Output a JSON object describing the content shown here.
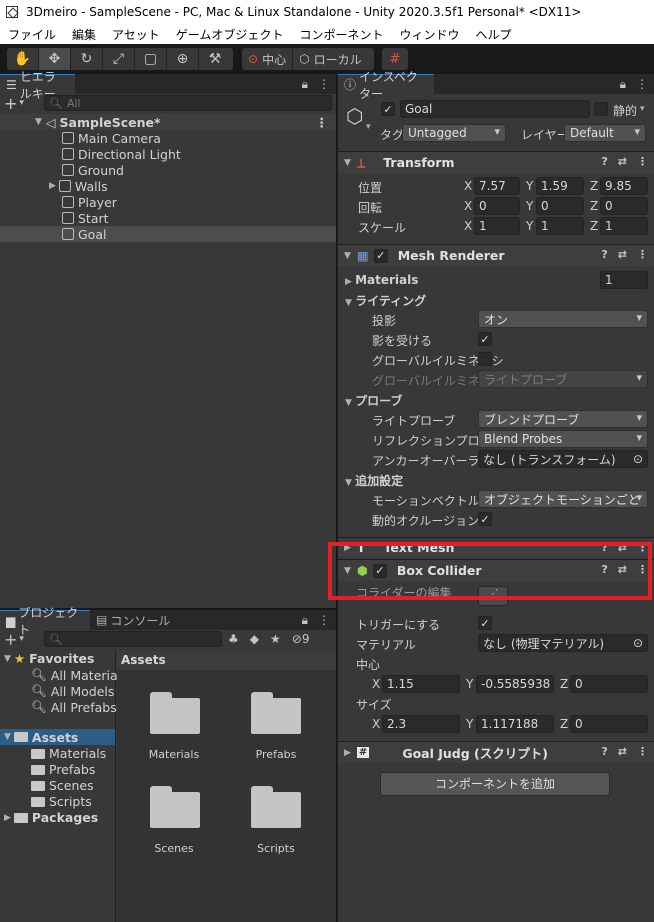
{
  "window": {
    "title": "3Dmeiro - SampleScene - PC, Mac & Linux Standalone - Unity 2020.3.5f1 Personal* <DX11>"
  },
  "menu": [
    "ファイル",
    "編集",
    "アセット",
    "ゲームオブジェクト",
    "コンポーネント",
    "ウィンドウ",
    "ヘルプ"
  ],
  "toolbar": {
    "pivot_label": "中心",
    "space_label": "ローカル"
  },
  "hierarchy": {
    "tab": "ヒエラルキー",
    "search_placeholder": "All",
    "scene": "SampleScene*",
    "items": [
      "Main Camera",
      "Directional Light",
      "Ground",
      "Walls",
      "Player",
      "Start",
      "Goal"
    ],
    "selected": "Goal"
  },
  "inspector": {
    "tab": "インスペクター",
    "object_name": "Goal",
    "static_label": "静的",
    "tag_label": "タグ",
    "tag_value": "Untagged",
    "layer_label": "レイヤー",
    "layer_value": "Default",
    "transform": {
      "title": "Transform",
      "position_label": "位置",
      "rotation_label": "回転",
      "scale_label": "スケール",
      "position": [
        "7.57",
        "1.59",
        "9.85"
      ],
      "rotation": [
        "0",
        "0",
        "0"
      ],
      "scale": [
        "1",
        "1",
        "1"
      ],
      "axis_x": "X",
      "axis_y": "Y",
      "axis_z": "Z"
    },
    "mesh_renderer": {
      "title": "Mesh Renderer",
      "materials_label": "Materials",
      "materials_count": "1",
      "lighting_label": "ライティング",
      "cast_shadows_label": "投影",
      "cast_shadows_value": "オン",
      "receive_shadows_label": "影を受ける",
      "gi_label": "グローバルイルミネーシ",
      "gi_label2": "グローバルイルミネーシ",
      "gi_value": "ライトプローブ",
      "probes_label": "プローブ",
      "light_probes_label": "ライトプローブ",
      "light_probes_value": "ブレンドプローブ",
      "reflection_label": "リフレクションプローブ",
      "reflection_value": "Blend Probes",
      "anchor_label": "アンカーオーバーライド",
      "anchor_value": "なし (トランスフォーム)",
      "additional_label": "追加設定",
      "motion_label": "モーションベクトル",
      "motion_value": "オブジェクトモーションごと",
      "occlusion_label": "動的オクルージョン"
    },
    "text_mesh_title": "Text Mesh",
    "box_collider": {
      "title": "Box Collider",
      "edit_label": "コライダーの編集",
      "trigger_label": "トリガーにする",
      "material_label": "マテリアル",
      "material_value": "なし (物理マテリアル)",
      "center_label": "中心",
      "center": [
        "1.15",
        "-0.5585938",
        "0"
      ],
      "size_label": "サイズ",
      "size": [
        "2.3",
        "1.117188",
        "0"
      ]
    },
    "goal_script_title": "Goal Judg (スクリプト)",
    "add_component": "コンポーネントを追加"
  },
  "project": {
    "tab_project": "プロジェクト",
    "tab_console": "コンソール",
    "hidden_count": "9",
    "favorites_label": "Favorites",
    "favorites": [
      "All Material",
      "All Models",
      "All Prefabs"
    ],
    "assets_label": "Assets",
    "asset_folders": [
      "Materials",
      "Prefabs",
      "Scenes",
      "Scripts"
    ],
    "packages_label": "Packages",
    "breadcrumb": "Assets",
    "grid": [
      "Materials",
      "Prefabs",
      "Scenes",
      "Scripts"
    ]
  },
  "colors": {
    "highlight_box": "#e2202a",
    "selection_blue": "#2c5d87",
    "tab_accent": "#3a79bb"
  }
}
